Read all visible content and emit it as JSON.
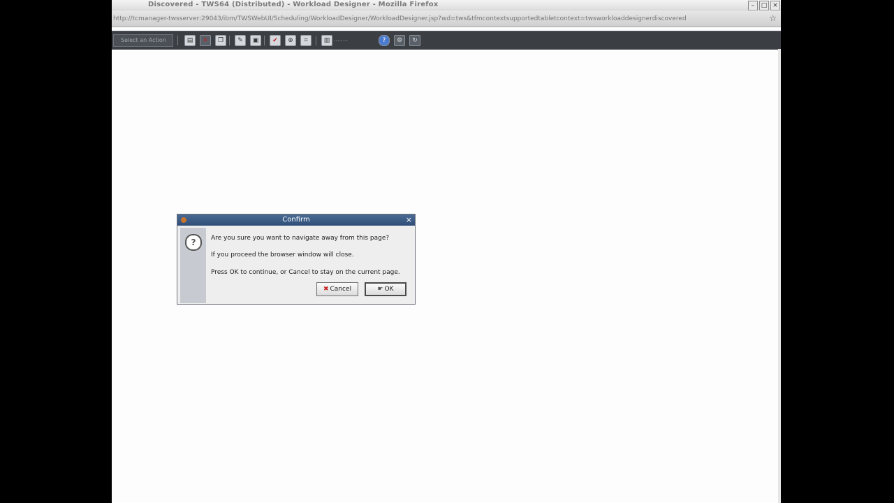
{
  "browser": {
    "title": "Discovered - TWS64 (Distributed) - Workload Designer - Mozilla Firefox",
    "window_buttons": [
      "minimize",
      "maximize",
      "close"
    ],
    "url": "http://tcmanager-twsserver:29043/ibm/TWSWebUI/Scheduling/WorkloadDesigner/WorkloadDesigner.jsp?wd=tws&tfmcontextsupportedtabletcontext=twsworkloaddesignerdiscovered"
  },
  "app_toolbar": {
    "select_placeholder": "Select an Action"
  },
  "dialog": {
    "title": "Confirm",
    "close_glyph": "×",
    "icon_glyph": "?",
    "lines": [
      "Are you sure you want to navigate away from this page?",
      "If you proceed the browser window will close.",
      "Press OK to continue, or Cancel to stay on the current page."
    ],
    "cancel_label": "Cancel",
    "ok_label": "OK"
  },
  "colors": {
    "dialog_title_bg": "#2f4e78",
    "toolbar_bg": "#3b3f44",
    "cancel_icon": "#c62020"
  }
}
